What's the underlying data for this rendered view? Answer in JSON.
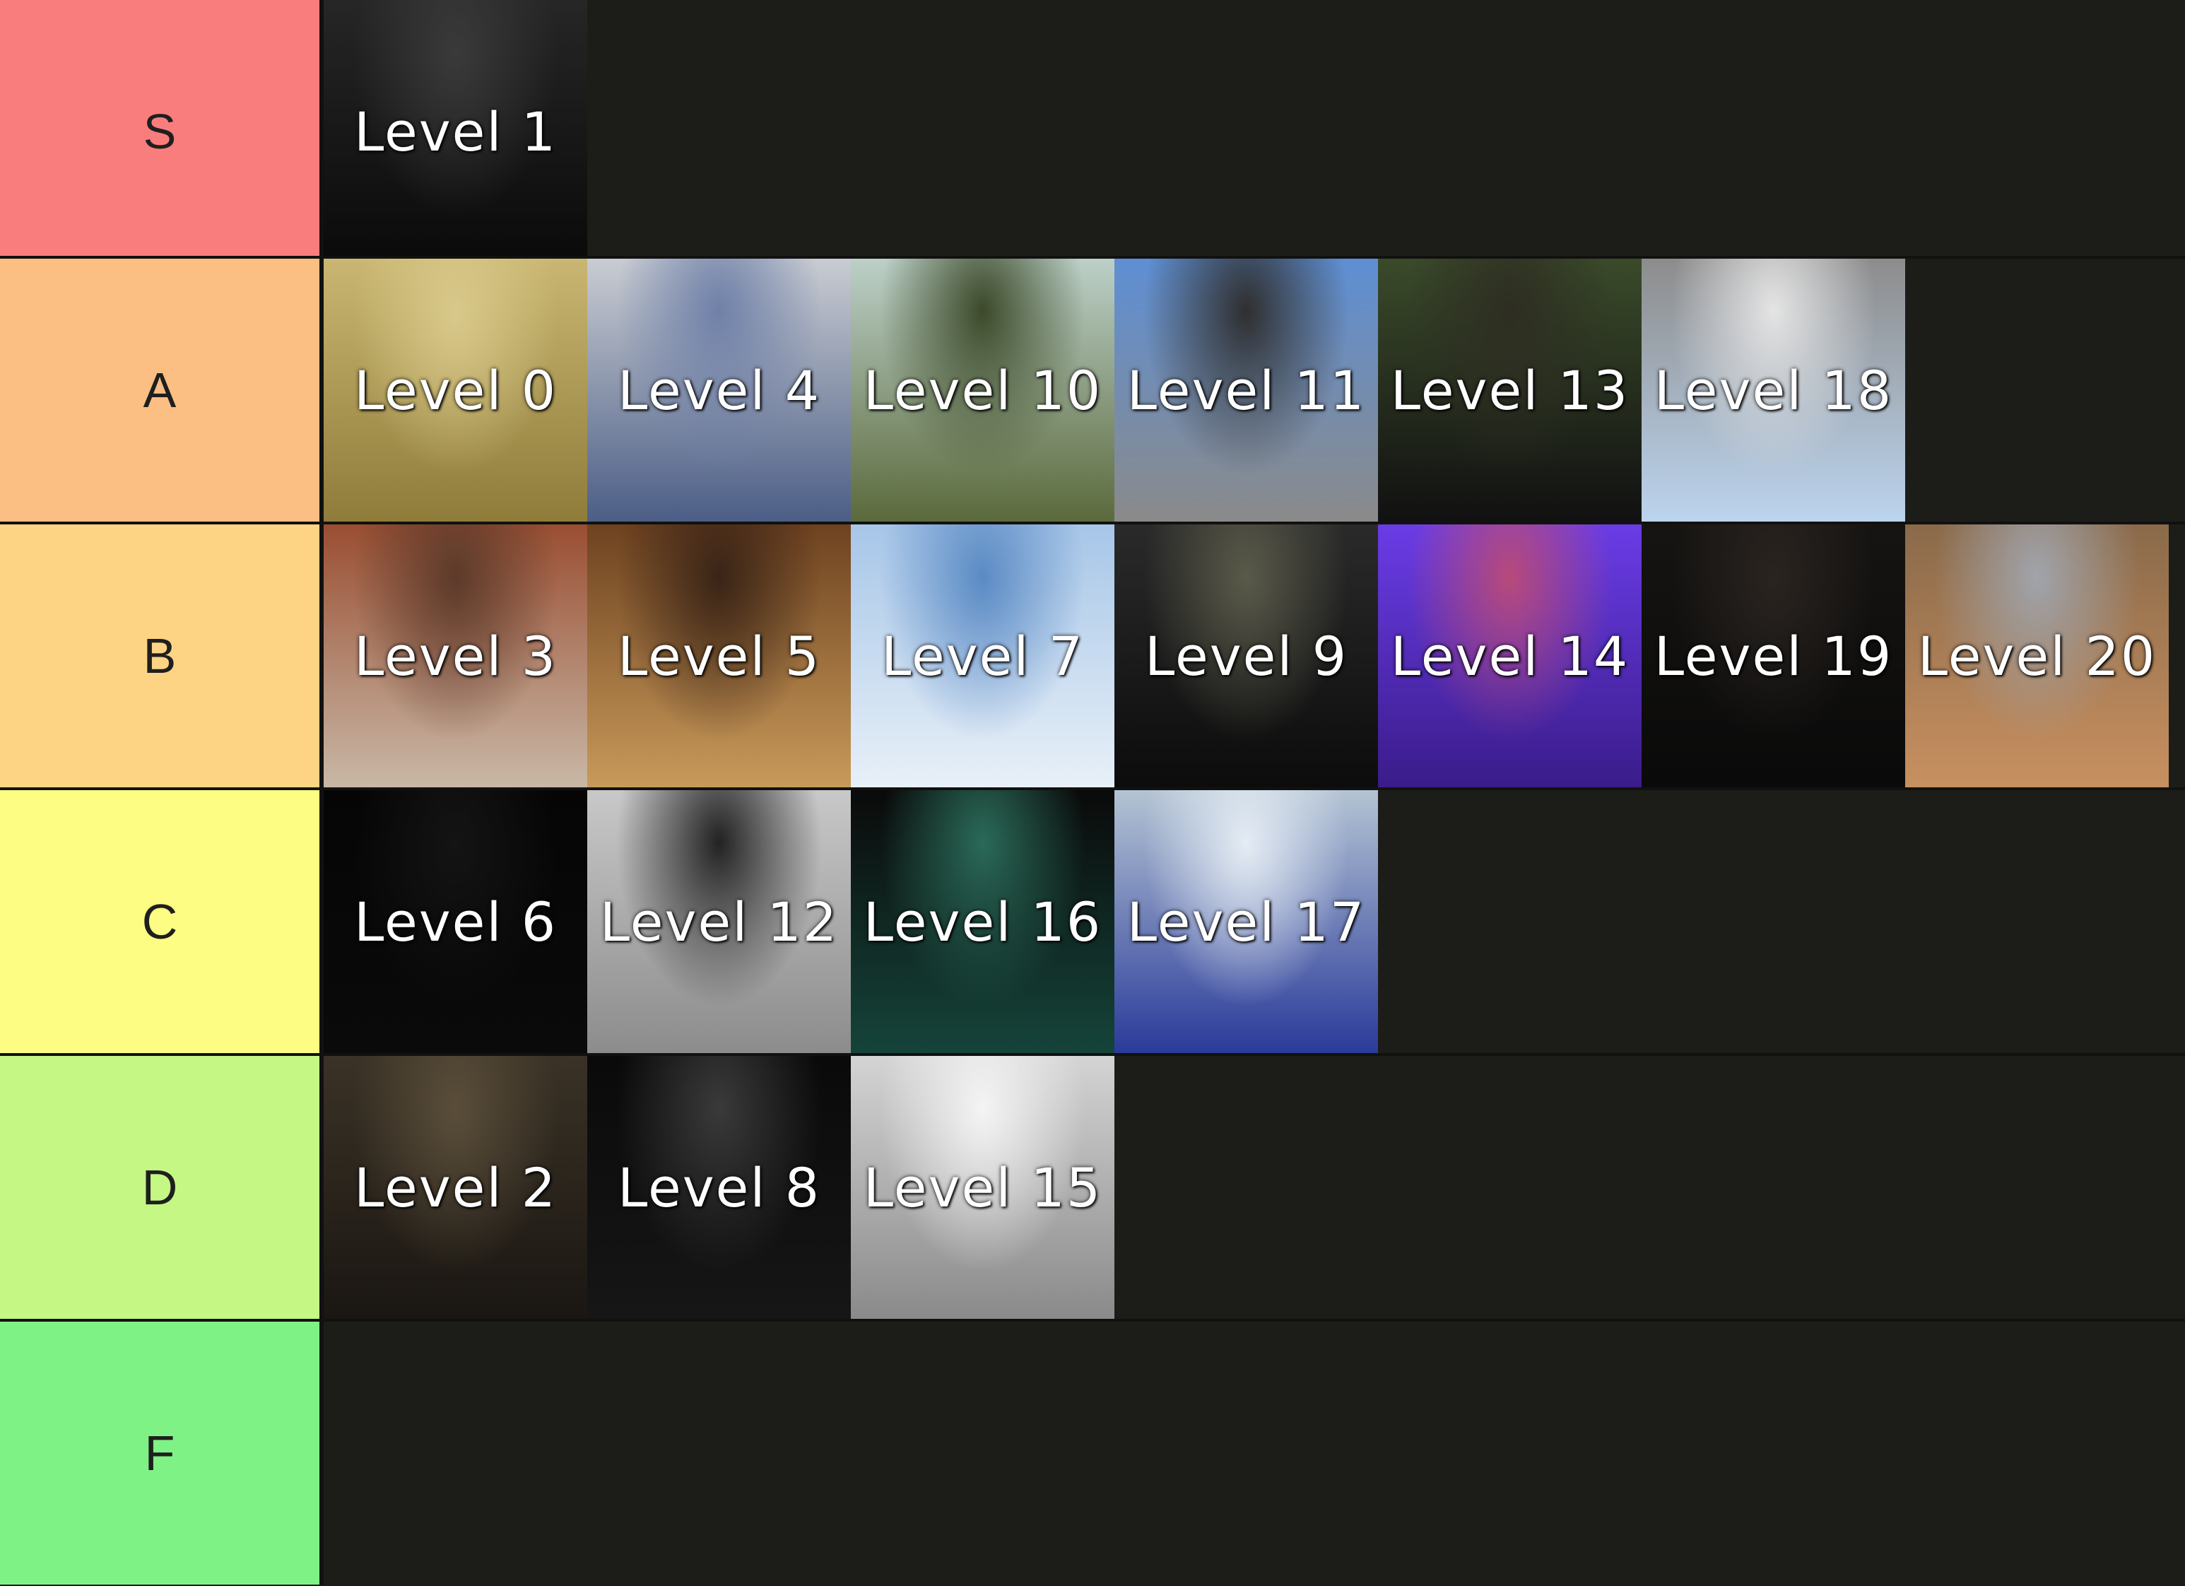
{
  "tiers": [
    {
      "label": "S",
      "color": "#f97d7c",
      "items": [
        {
          "label": "Level 1",
          "palette": [
            "#262626",
            "#0a0a0a",
            "#3a3a3a"
          ]
        }
      ]
    },
    {
      "label": "A",
      "color": "#fbbe83",
      "items": [
        {
          "label": "Level 0",
          "palette": [
            "#c9b672",
            "#8f7c3a",
            "#d9c98a"
          ]
        },
        {
          "label": "Level 4",
          "palette": [
            "#c9ccd2",
            "#4c5e86",
            "#6f80a8"
          ]
        },
        {
          "label": "Level 10",
          "palette": [
            "#bcd0c8",
            "#5b6a3c",
            "#3c4a2a"
          ]
        },
        {
          "label": "Level 11",
          "palette": [
            "#5e8fd4",
            "#8a8a8a",
            "#2f2f2f"
          ]
        },
        {
          "label": "Level 13",
          "palette": [
            "#3a4a2a",
            "#111111",
            "#2e2e22"
          ]
        },
        {
          "label": "Level 18",
          "palette": [
            "#8c8c8c",
            "#bcd4ee",
            "#e4e4e4"
          ]
        }
      ]
    },
    {
      "label": "B",
      "color": "#fcd483",
      "items": [
        {
          "label": "Level 3",
          "palette": [
            "#9a4e32",
            "#c8b8a6",
            "#5c3a2a"
          ]
        },
        {
          "label": "Level 5",
          "palette": [
            "#6e4220",
            "#c89a5a",
            "#3a2416"
          ]
        },
        {
          "label": "Level 7",
          "palette": [
            "#a7c6e8",
            "#e8f0f8",
            "#5a8ac4"
          ]
        },
        {
          "label": "Level 9",
          "palette": [
            "#2a2a2a",
            "#0c0c0c",
            "#5a5a4a"
          ]
        },
        {
          "label": "Level 14",
          "palette": [
            "#6a3ce6",
            "#3a1c8a",
            "#b84a7a"
          ]
        },
        {
          "label": "Level 19",
          "palette": [
            "#161412",
            "#0a0a0a",
            "#2a2420"
          ]
        },
        {
          "label": "Level 20",
          "palette": [
            "#8a6a4a",
            "#c89060",
            "#a0a4ac"
          ]
        }
      ]
    },
    {
      "label": "C",
      "color": "#fdfd83",
      "items": [
        {
          "label": "Level 6",
          "palette": [
            "#050505",
            "#0a0a0a",
            "#141414"
          ]
        },
        {
          "label": "Level 12",
          "palette": [
            "#c8c8c8",
            "#8c8c8c",
            "#222222"
          ]
        },
        {
          "label": "Level 16",
          "palette": [
            "#0a0a0a",
            "#15443a",
            "#2a6a58"
          ]
        },
        {
          "label": "Level 17",
          "palette": [
            "#b4c4d4",
            "#2a3a9a",
            "#e4ecf4"
          ]
        }
      ]
    },
    {
      "label": "D",
      "color": "#c4f783",
      "items": [
        {
          "label": "Level 2",
          "palette": [
            "#3a3226",
            "#1a1612",
            "#5a4e3a"
          ]
        },
        {
          "label": "Level 8",
          "palette": [
            "#0a0a0a",
            "#161616",
            "#3a3a3a"
          ]
        },
        {
          "label": "Level 15",
          "palette": [
            "#d4d4d4",
            "#8a8a8a",
            "#f4f4f4"
          ]
        }
      ]
    },
    {
      "label": "F",
      "color": "#7ff286",
      "items": []
    }
  ]
}
